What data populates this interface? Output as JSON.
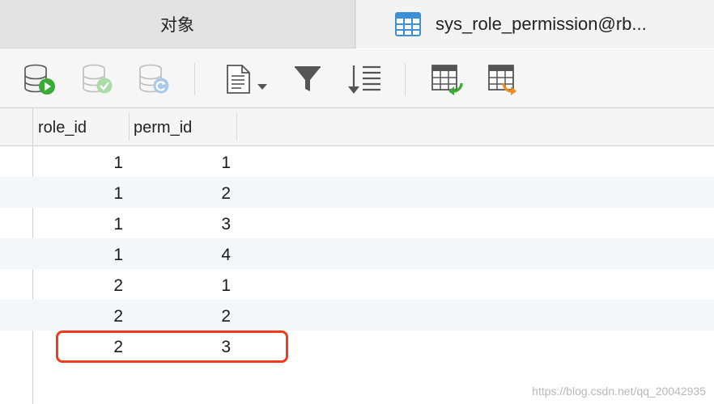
{
  "tabs": [
    {
      "label": "对象"
    },
    {
      "label": "sys_role_permission@rb..."
    }
  ],
  "toolbar": {
    "buttons": [
      {
        "icon": "database-run-icon"
      },
      {
        "icon": "database-commit-icon"
      },
      {
        "icon": "database-refresh-icon"
      },
      {
        "icon": "document-dropdown-icon"
      },
      {
        "icon": "filter-icon"
      },
      {
        "icon": "sort-icon"
      },
      {
        "icon": "table-import-icon"
      },
      {
        "icon": "table-export-icon"
      }
    ]
  },
  "grid": {
    "columns": [
      "role_id",
      "perm_id"
    ],
    "rows": [
      [
        "1",
        "1"
      ],
      [
        "1",
        "2"
      ],
      [
        "1",
        "3"
      ],
      [
        "1",
        "4"
      ],
      [
        "2",
        "1"
      ],
      [
        "2",
        "2"
      ],
      [
        "2",
        "3"
      ]
    ],
    "highlighted_row_index": 6,
    "highlight_color": "#f03c1e"
  },
  "watermark": "https://blog.csdn.net/qq_20042935"
}
